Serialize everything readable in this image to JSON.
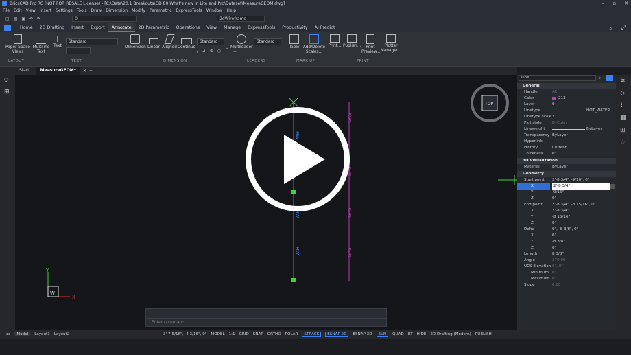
{
  "title": "BricsCAD Pro RC (NOT FOR RESALE License) - [C:\\Data\\20.1 Breakouts\\GD 80 What's new in Lite and Pro\\Dataset\\MeasureGEOM.dwg]",
  "menu": [
    "File",
    "Edit",
    "View",
    "Insert",
    "Settings",
    "Tools",
    "Draw",
    "Dimension",
    "Modify",
    "Parametric",
    "ExpressTools",
    "Window",
    "Help"
  ],
  "qat": {
    "layer_value": "0",
    "visual_style": "2dWireframe"
  },
  "ribbon_tabs": [
    "Home",
    "2D Drafting",
    "Insert",
    "Export",
    "Annotate",
    "2D Parametric",
    "Operations",
    "View",
    "Manage",
    "ExpressTools",
    "Productivity",
    "AI Predict"
  ],
  "ribbon": {
    "paper_space_views": "Paper Space Views",
    "multiline_text": "Multiline Text",
    "text": "Text",
    "text_style": "Standard",
    "dimension": "Dimension",
    "linear": "Linear",
    "aligned": "Aligned",
    "continue": "Continue",
    "dim_style": "Standard",
    "multileader": "Multileader",
    "leader_style": "Standard",
    "table": "Table",
    "add_delete_scales": "Add/Delete Scales...",
    "print": "Print...",
    "publish": "Publish...",
    "print_preview": "Print Preview...",
    "plotter_manager": "Plotter Manager...",
    "groups": {
      "layout": "LAYOUT",
      "text": "TEXT",
      "dimension": "DIMENSION",
      "leaders": "LEADERS",
      "markup": "MARK UP",
      "print": "PRINT"
    }
  },
  "doc_tabs": [
    "Start",
    "MeasureGEOM*"
  ],
  "viewcube": "TOP",
  "labels": {
    "hw": "HW",
    "gas": "GAS",
    "ucs_y": "Y",
    "ucs_x": "X",
    "ucs_w": "W"
  },
  "props": {
    "selector": "Line",
    "general": "General",
    "handle_k": "Handle",
    "handle_v": "AE",
    "color_k": "Color",
    "color_v": "213",
    "layer_k": "Layer",
    "layer_v": "0",
    "linetype_k": "Linetype",
    "linetype_v": "HOT_WATER...",
    "ltscale_k": "Linetype scale",
    "ltscale_v": "2",
    "plotstyle_k": "Plot style",
    "plotstyle_v": "ByColor",
    "lw_k": "Lineweight",
    "lw_v": "ByLayer",
    "transp_k": "Transparency",
    "transp_v": "ByLayer",
    "hyper_k": "Hyperlink",
    "hyper_v": "",
    "history_k": "History",
    "history_v": "Current",
    "thick_k": "Thickness",
    "thick_v": "0\"",
    "viz": "3D Visualization",
    "mat_k": "Material",
    "mat_v": "ByLayer",
    "geom": "Geometry",
    "start_k": "Start point",
    "start_v": "2'-8 3/4\", -9/16\", 0\"",
    "sx_k": "X",
    "sx_v": "2'-8 3/4\"",
    "sy_k": "Y",
    "sy_v": "-9/16\"",
    "sz_k": "Z",
    "sz_v": "0\"",
    "end_k": "End point",
    "end_v": "2'-8 3/4\", -8 15/16\", 0\"",
    "ex_k": "X",
    "ex_v": "2'-8 3/4\"",
    "ey_k": "Y",
    "ey_v": "-8 15/16\"",
    "ez_k": "Z",
    "ez_v": "0\"",
    "delta_k": "Delta",
    "delta_v": "0\", -8 3/8\", 0\"",
    "dx_k": "X",
    "dx_v": "0\"",
    "dy_k": "Y",
    "dy_v": "-8 3/8\"",
    "dz_k": "Z",
    "dz_v": "0\"",
    "length_k": "Length",
    "length_v": "8 3/8\"",
    "angle_k": "Angle",
    "angle_v": "270.00",
    "ucs_k": "UCS Elevation",
    "ucs_v": "0\", 0\"",
    "min_k": "Minimum",
    "min_v": "0\"",
    "max_k": "Maximum",
    "max_v": "0\"",
    "slope_k": "Slope",
    "slope_v": "0.00"
  },
  "command_placeholder": ": Enter command",
  "status": {
    "model": "Model",
    "layout1": "Layout1",
    "layout2": "Layout2",
    "coords": "3'-7 5/16\", -4 3/16\", 0\"",
    "items": [
      "MODEL",
      "1:1",
      "GRID",
      "SNAP",
      "ORTHO",
      "POLAR",
      "STRACK",
      "ESNAP 2D",
      "ESNAP 3D",
      "EVN",
      "QUAD",
      "RT",
      "HIDE",
      "2D Drafting (Modern)",
      "PUBLISH"
    ]
  },
  "colors": {
    "accent": "#3b82f6",
    "hw": "#3b82f6",
    "gas": "#b63cb8",
    "grip": "#3fd13f"
  }
}
